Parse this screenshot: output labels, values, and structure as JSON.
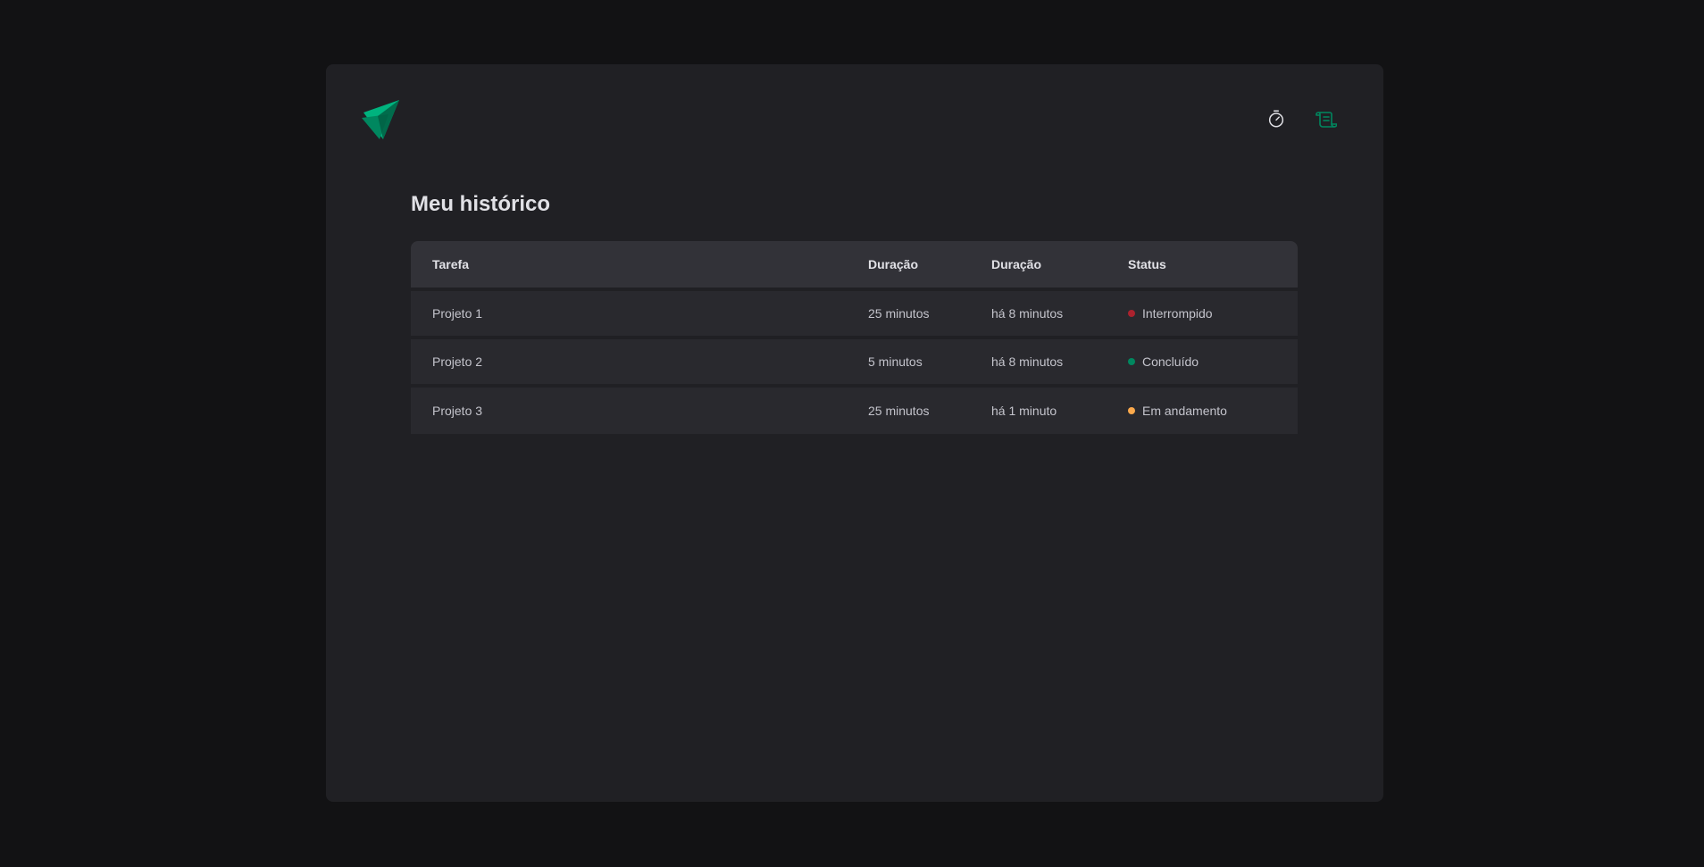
{
  "header": {
    "logo": "ignite-timer-logo",
    "nav": [
      {
        "icon": "timer-icon",
        "color": "#e1e1e6",
        "active": false
      },
      {
        "icon": "scroll-icon",
        "color": "#00875f",
        "active": true
      }
    ]
  },
  "history": {
    "title": "Meu histórico",
    "columns": [
      "Tarefa",
      "Duração",
      "Duração",
      "Status"
    ],
    "rows": [
      {
        "task": "Projeto 1",
        "duration": "25 minutos",
        "started": "há 8 minutos",
        "status": "Interrompido",
        "status_color": "#ab222e"
      },
      {
        "task": "Projeto 2",
        "duration": "5 minutos",
        "started": "há 8 minutos",
        "status": "Concluído",
        "status_color": "#00875f"
      },
      {
        "task": "Projeto 3",
        "duration": "25 minutos",
        "started": "há 1 minuto",
        "status": "Em andamento",
        "status_color": "#fba94c"
      }
    ]
  },
  "colors": {
    "background": "#121214",
    "panel": "#202024",
    "header_row": "#323238",
    "row": "#29292e",
    "accent": "#00875f"
  }
}
